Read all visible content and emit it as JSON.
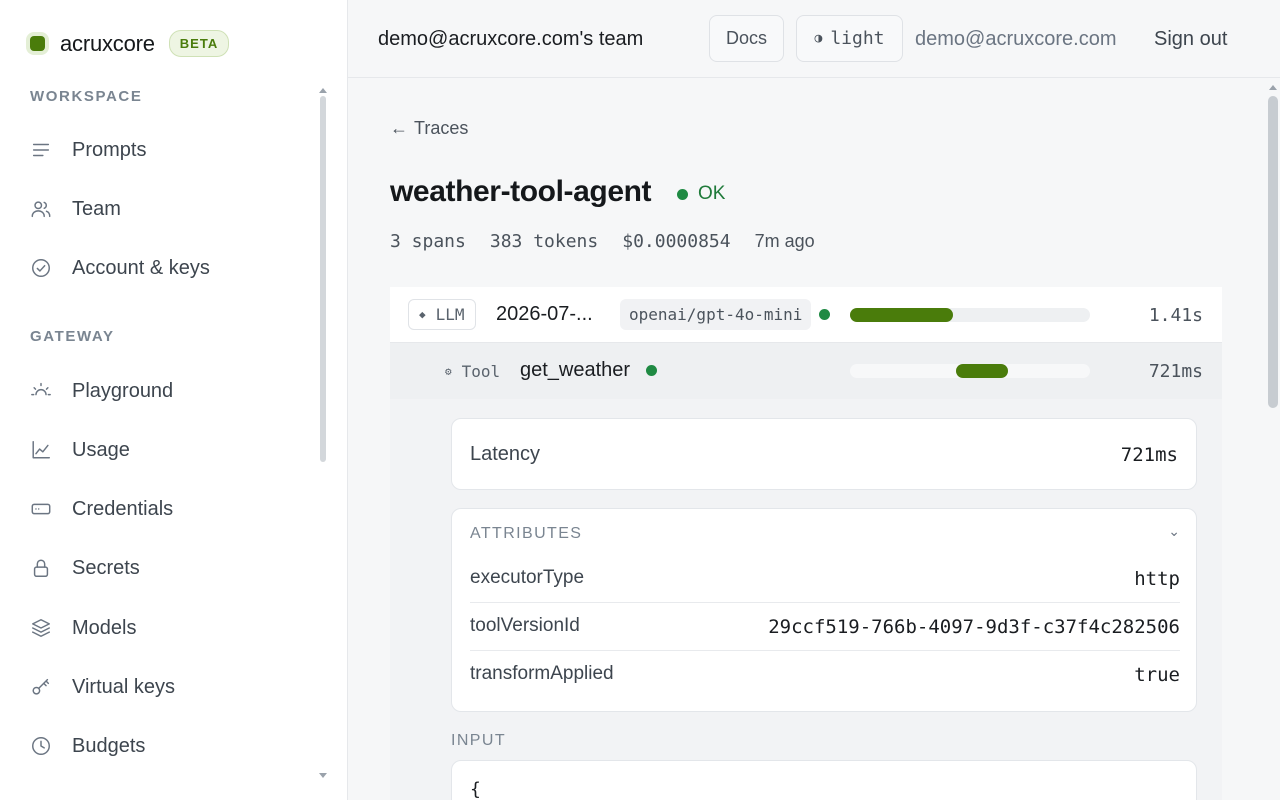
{
  "brand": {
    "name": "acruxcore",
    "badge": "BETA"
  },
  "sidebar": {
    "sections": [
      {
        "label": "WORKSPACE",
        "items": [
          {
            "label": "Prompts",
            "icon": "lines-icon"
          },
          {
            "label": "Team",
            "icon": "users-icon"
          },
          {
            "label": "Account & keys",
            "icon": "check-circle-icon"
          }
        ]
      },
      {
        "label": "GATEWAY",
        "items": [
          {
            "label": "Playground",
            "icon": "sun-icon"
          },
          {
            "label": "Usage",
            "icon": "chart-icon"
          },
          {
            "label": "Credentials",
            "icon": "card-icon"
          },
          {
            "label": "Secrets",
            "icon": "lock-icon"
          },
          {
            "label": "Models",
            "icon": "layers-icon"
          },
          {
            "label": "Virtual keys",
            "icon": "key-icon"
          },
          {
            "label": "Budgets",
            "icon": "clock-icon"
          }
        ]
      }
    ]
  },
  "topbar": {
    "team": "demo@acruxcore.com's team",
    "docs": "Docs",
    "theme": "light",
    "email": "demo@acruxcore.com",
    "signout": "Sign out"
  },
  "trace": {
    "back": "Traces",
    "name": "weather-tool-agent",
    "status": "OK",
    "meta": {
      "spans": "3 spans",
      "tokens": "383 tokens",
      "cost": "$0.0000854",
      "age": "7m ago"
    }
  },
  "spans": [
    {
      "kind": "LLM",
      "name": "2026-07-...",
      "model": "openai/gpt-4o-mini",
      "duration": "1.41s",
      "bar_start": 0.0,
      "bar_fraction": 0.43
    },
    {
      "kind": "Tool",
      "name": "get_weather",
      "model": "",
      "duration": "721ms",
      "bar_start": 0.44,
      "bar_fraction": 0.22
    }
  ],
  "detail": {
    "latency_label": "Latency",
    "latency_value": "721ms",
    "attributes_label": "ATTRIBUTES",
    "attributes": [
      {
        "key": "executorType",
        "value": "http"
      },
      {
        "key": "toolVersionId",
        "value": "29ccf519-766b-4097-9d3f-c37f4c282506"
      },
      {
        "key": "transformApplied",
        "value": "true"
      }
    ],
    "input_label": "INPUT",
    "input_code": "{"
  },
  "colors": {
    "accent": "#4a7c0b",
    "ok": "#1f8a43"
  }
}
